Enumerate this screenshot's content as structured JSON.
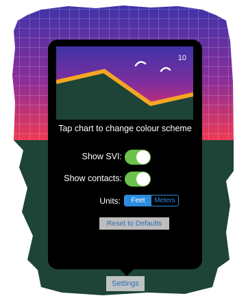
{
  "chart_preview": {
    "corner_value": "10",
    "bird_icon_count": 2
  },
  "hint": "Tap chart to change colour scheme",
  "rows": {
    "show_svi": {
      "label": "Show SVI:",
      "on": true
    },
    "show_contacts": {
      "label": "Show contacts:",
      "on": true
    }
  },
  "units": {
    "label": "Units:",
    "options": [
      "Feet",
      "Meters"
    ],
    "selected": "Feet"
  },
  "buttons": {
    "reset": "Reset to Defaults",
    "settings": "Settings"
  },
  "colors": {
    "sky_top": "#3f33a8",
    "sky_mid": "#7e2e9c",
    "sky_bottom": "#ef2c63",
    "ground": "#1d4436",
    "ridge": "#f5a623",
    "toggle_on": "#6cc24a",
    "accent": "#2c8de0"
  }
}
